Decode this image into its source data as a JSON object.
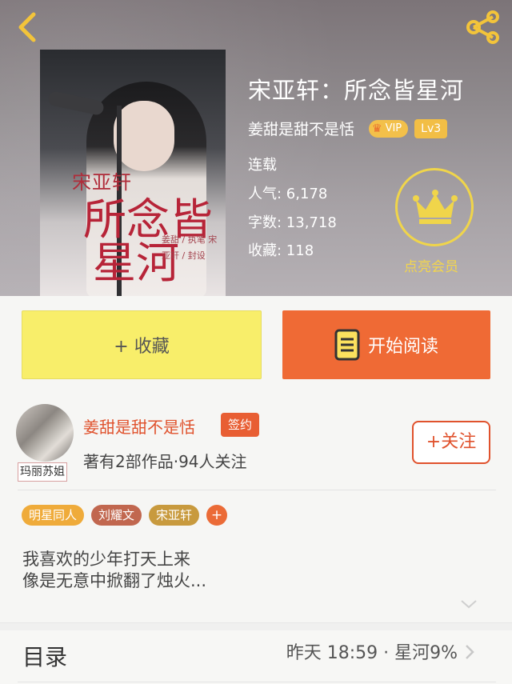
{
  "header": {
    "back_icon": "chevron-left-icon",
    "share_icon": "share-icon",
    "cover": {
      "name": "宋亚轩",
      "title_line1": "所念皆",
      "title_line2": "星河",
      "credits": "姜甜 / 执笔  宋亚轩 / 封设"
    },
    "book_title": "宋亚轩：所念皆星河",
    "author_name": "姜甜是甜不是恬",
    "vip_label": "VIP",
    "level_label": "Lv3",
    "status": "连载",
    "stats": [
      {
        "label": "人气: 6,178"
      },
      {
        "label": "字数: 13,718"
      },
      {
        "label": "收藏: 118"
      }
    ],
    "member_label": "点亮会员"
  },
  "actions": {
    "collect_label": "+ 收藏",
    "read_label": "开始阅读"
  },
  "author_card": {
    "avatar_caption": "玛丽苏姐",
    "name": "姜甜是甜不是恬",
    "sign_badge": "签约",
    "works": "著有2部作品·94人关注",
    "follow_label": "+关注"
  },
  "tags": [
    "明星同人",
    "刘耀文",
    "宋亚轩"
  ],
  "tag_add": "+",
  "description": {
    "line1": "我喜欢的少年打天上来",
    "line2": "像是无意中掀翻了烛火..."
  },
  "toc": {
    "label": "目录",
    "update": "昨天 18:59 · 星河9%"
  },
  "colors": {
    "accent": "#ef6a35",
    "collect_yellow": "#f8ee6a",
    "member_gold": "#f0d54a"
  }
}
